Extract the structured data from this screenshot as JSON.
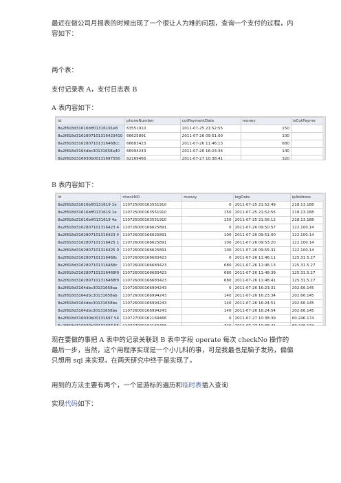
{
  "paragraphs": [
    "最近在做公司月报表的时候出现了一个很让人为难的问题，查询一个支付的过程，内容如下：",
    "两个表：",
    "支付记录表 A，支付日志表 B",
    "A 表内容如下：",
    "B 表内容如下：",
    "现在要做的事把 A 表中的记录关联到 B 表中字段 operate 每次 checkNo 操作的最后一步，当然，这个用程序实现是一个小儿科的事，可是我最也是脑子发热，偏偏只想用 sql 来实现，在两天研究中终于是实现了。"
  ],
  "method_text": {
    "before": "用到的方法主要有两个，一个是游标的遍历和",
    "link": "临时表",
    "after": "插入查询"
  },
  "code_text": {
    "before": "实现",
    "link": "代码",
    "after": "如下："
  },
  "table_a": {
    "columns": [
      "id",
      "phoneNumber",
      "cutPaymentDate",
      "money",
      "isCutPayme"
    ],
    "rows": [
      [
        "8a2f818d31616bff01316191e6",
        "63551910",
        "2011-07-25 21:52:55",
        "150",
        ""
      ],
      [
        "8a2f818d3162807101316423410",
        "66625891",
        "2011-07-26 09:51:00",
        "100",
        ""
      ],
      [
        "8a2f818d3162807101316468cc",
        "66683423",
        "2011-07-26 11:46:13",
        "680",
        ""
      ],
      [
        "8a2f818d3164dbc30131658a40",
        "66994243",
        "2011-07-26 16:23:34",
        "140",
        ""
      ],
      [
        "8a2f818d316930b00131697550",
        "62169466",
        "2011-07-27 10:38:41",
        "320",
        ""
      ]
    ]
  },
  "table_b": {
    "columns": [
      "id",
      "checkNO",
      "money",
      "logDate",
      "ipAddress"
    ],
    "rows": [
      [
        "8a2f818d31616bff0131619 1e",
        "110725000163551910",
        "0",
        "2011-07-25 21:52:49",
        "218.13.188"
      ],
      [
        "8a2f818d31616bff0131619 1e",
        "110725000163551910",
        "150",
        "2011-07-25 21:52:55",
        "218.13.188"
      ],
      [
        "8a2f818d31616bff0131619 4a",
        "110725000163551910",
        "150",
        "2011-07-25 21:56:12",
        "218.13.188"
      ],
      [
        "8a2f818d3162807101316423 4",
        "110726000166625891",
        "0",
        "2011-07-26 09:50:57",
        "122.100.14"
      ],
      [
        "8a2f818d3162807101316423 4",
        "110726000166625891",
        "100",
        "2011-07-26 09:51:00",
        "122.100.14"
      ],
      [
        "8a2f818d3162807101316425 1",
        "110726000166625891",
        "100",
        "2011-07-26 09:53:20",
        "122.100.14"
      ],
      [
        "8a2f818d3162807101316425 0",
        "110726000166625891",
        "100",
        "2011-07-26 09:55:31",
        "122.100.14"
      ],
      [
        "8a2f818d3162807101316468c",
        "110726000166683423",
        "0",
        "2011-07-26 11:46:11",
        "125.31.5.27"
      ],
      [
        "8a2f818d3162807101316468c",
        "110726000166683423",
        "680",
        "2011-07-26 11:46:13",
        "125.31.5.27"
      ],
      [
        "8a2f818d3162807101316468f0",
        "110726000166683423",
        "680",
        "2011-07-26 11:48:39",
        "125.31.5.27"
      ],
      [
        "8a2f818d3162807101316468f0",
        "110726000166683423",
        "680",
        "2011-07-26 11:48:41",
        "125.31.5.27"
      ],
      [
        "8a2f818d3164dbc30131658aa",
        "110726000166994243",
        "0",
        "2011-07-26 16:23:31",
        "202.66.145"
      ],
      [
        "8a2f818d3164dbc30131658ab",
        "110726000166994243",
        "140",
        "2011-07-26 16:23:34",
        "202.66.145"
      ],
      [
        "8a2f818d3164dbc30131658be",
        "110726000166994243",
        "140",
        "2011-07-26 16:24:51",
        "202.66.145"
      ],
      [
        "8a2f818d3164dbc30131658be",
        "110726000166994243",
        "140",
        "2011-07-26 16:24:54",
        "202.66.145"
      ],
      [
        "8a2f818d316930b00131697 54",
        "110727000162169466",
        "0",
        "2011-07-27 10:38:39",
        "60.246.174"
      ],
      [
        "8a2f818d316930b00131697 55",
        "110727000162169466",
        "320",
        "2011-07-27 10:38:41",
        "60.246.174"
      ]
    ]
  }
}
